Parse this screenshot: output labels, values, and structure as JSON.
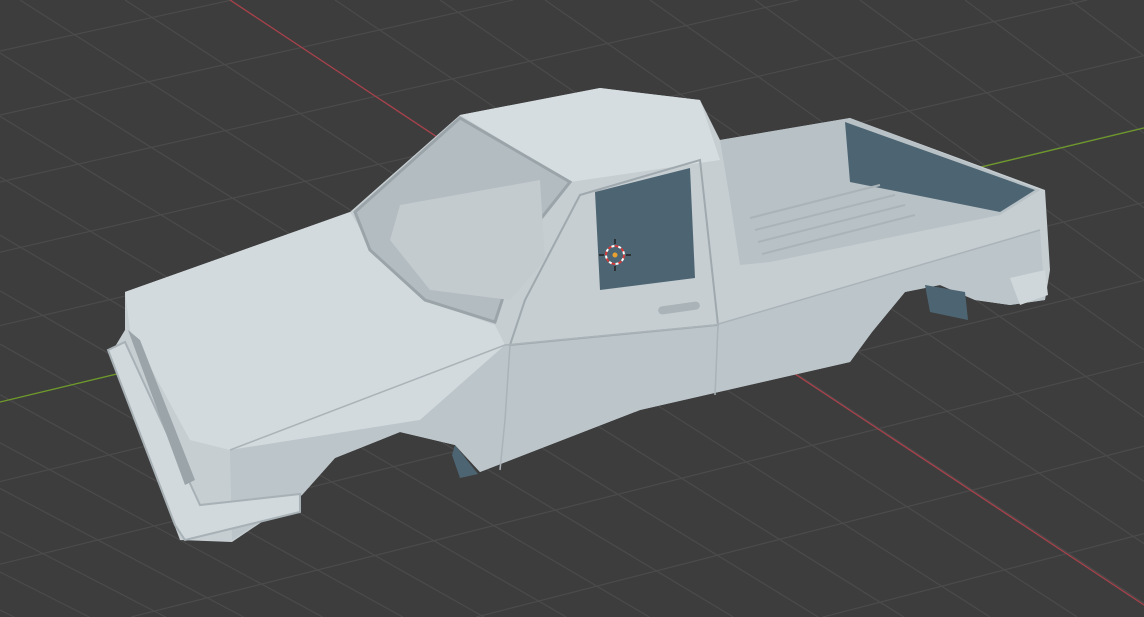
{
  "viewport": {
    "background_color": "#3d3d3d",
    "grid_color": "#4b4b4b",
    "x_axis_color": "#a8404a",
    "y_axis_color": "#6e9a2a",
    "model_color": "#c9d1d5",
    "model_shadow_color": "#4d6572",
    "cursor_icon": "3d-cursor-icon"
  }
}
